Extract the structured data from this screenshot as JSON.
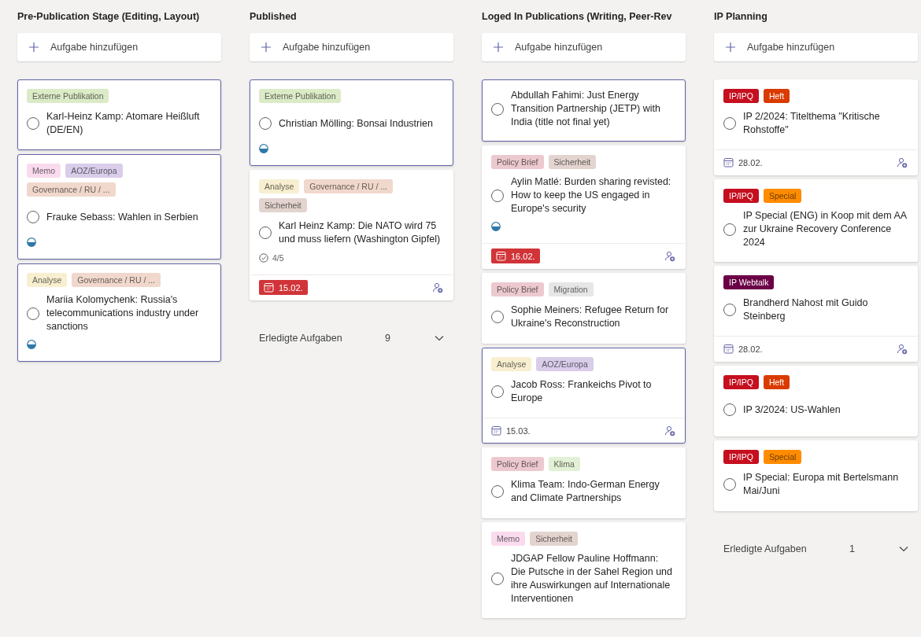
{
  "columns": [
    {
      "title": "Pre-Publication Stage (Editing, Layout)",
      "add_label": "Aufgabe hinzufügen",
      "cards": [
        {
          "selected": true,
          "labels": [
            {
              "text": "Externe Publikation",
              "color": "#dbebc7"
            }
          ],
          "title": "Karl-Heinz Kamp: Atomare Heißluft (DE/EN)",
          "in_progress": false
        },
        {
          "selected": true,
          "labels": [
            {
              "text": "Memo",
              "color": "#fadbee"
            },
            {
              "text": "AOZ/Europa",
              "color": "#d9cdea"
            },
            {
              "text": "Governance / RU / ...",
              "color": "#f1d8cc"
            }
          ],
          "title": "Frauke Sebass: Wahlen in Serbien",
          "in_progress": true
        },
        {
          "selected": true,
          "labels": [
            {
              "text": "Analyse",
              "color": "#f7efd0"
            },
            {
              "text": "Governance / RU / ...",
              "color": "#f1d8cc"
            }
          ],
          "title": "Mariia Kolomychenk: Russia's telecommunications industry under sanctions",
          "in_progress": true
        }
      ]
    },
    {
      "title": "Published",
      "add_label": "Aufgabe hinzufügen",
      "cards": [
        {
          "selected": true,
          "labels": [
            {
              "text": "Externe Publikation",
              "color": "#dbebc7"
            }
          ],
          "title": "Christian Mölling: Bonsai Industrien",
          "in_progress": true
        },
        {
          "selected": false,
          "labels": [
            {
              "text": "Analyse",
              "color": "#f7efd0"
            },
            {
              "text": "Governance / RU / ...",
              "color": "#f1d8cc"
            },
            {
              "text": "Sicherheit",
              "color": "#e3d4cf"
            }
          ],
          "title": "Karl Heinz Kamp: Die NATO wird 75 und muss liefern (Washington Gipfel)",
          "in_progress": false,
          "checklist": "4/5",
          "due": {
            "date": "15.02.",
            "overdue": true
          }
        }
      ],
      "completed": {
        "label": "Erledigte Aufgaben",
        "count": "9"
      }
    },
    {
      "title": "Loged In Publications (Writing, Peer-Rev",
      "add_label": "Aufgabe hinzufügen",
      "cards": [
        {
          "selected": true,
          "title": "Abdullah Fahimi: Just Energy Transition Partnership (JETP) with India (title not final yet)",
          "in_progress": false
        },
        {
          "selected": false,
          "labels": [
            {
              "text": "Policy Brief",
              "color": "#ecc9cf"
            },
            {
              "text": "Sicherheit",
              "color": "#e3d4cf"
            }
          ],
          "title": "Aylin Matlé: Burden sharing revisted: How to keep the US engaged in Europe's security",
          "in_progress": true,
          "due": {
            "date": "16.02.",
            "overdue": true
          }
        },
        {
          "selected": false,
          "labels": [
            {
              "text": "Policy Brief",
              "color": "#ecc9cf"
            },
            {
              "text": "Migration",
              "color": "#e6e6e6"
            }
          ],
          "title": "Sophie Meiners: Refugee Return for Ukraine's Reconstruction",
          "in_progress": false
        },
        {
          "selected": true,
          "labels": [
            {
              "text": "Analyse",
              "color": "#f7efd0"
            },
            {
              "text": "AOZ/Europa",
              "color": "#d9cdea"
            }
          ],
          "title": "Jacob Ross: Frankeichs Pivot to Europe",
          "in_progress": false,
          "due": {
            "date": "15.03.",
            "overdue": false
          }
        },
        {
          "selected": false,
          "labels": [
            {
              "text": "Policy Brief",
              "color": "#ecc9cf"
            },
            {
              "text": "Klima",
              "color": "#e2f0d5"
            }
          ],
          "title": "Klima Team: Indo-German Energy and Climate Partnerships",
          "in_progress": false
        },
        {
          "selected": false,
          "labels": [
            {
              "text": "Memo",
              "color": "#fadbee"
            },
            {
              "text": "Sicherheit",
              "color": "#e3d4cf"
            }
          ],
          "title": "JDGAP Fellow Pauline Hoffmann: Die Putsche in der Sahel Region und ihre Auswirkungen auf Internationale Interventionen",
          "in_progress": false
        }
      ]
    },
    {
      "title": "IP Planning",
      "add_label": "Aufgabe hinzufügen",
      "cards": [
        {
          "selected": false,
          "labels": [
            {
              "text": "IP/IPQ",
              "color": "#c50f1f"
            },
            {
              "text": "Heft",
              "color": "#da3b01"
            }
          ],
          "title": "IP 2/2024: Titelthema \"Kritische Rohstoffe\"",
          "in_progress": false,
          "due": {
            "date": "28.02.",
            "overdue": false
          }
        },
        {
          "selected": false,
          "labels": [
            {
              "text": "IP/IPQ",
              "color": "#c50f1f"
            },
            {
              "text": "Special",
              "color": "#ff8c00"
            }
          ],
          "title": "IP Special (ENG) in Koop mit dem AA zur Ukraine Recovery Conference 2024",
          "in_progress": false
        },
        {
          "selected": false,
          "labels": [
            {
              "text": "IP Webtalk",
              "color": "#6b0046"
            }
          ],
          "title": "Brandherd Nahost mit Guido Steinberg",
          "in_progress": false,
          "due": {
            "date": "28.02.",
            "overdue": false
          }
        },
        {
          "selected": false,
          "labels": [
            {
              "text": "IP/IPQ",
              "color": "#c50f1f"
            },
            {
              "text": "Heft",
              "color": "#da3b01"
            }
          ],
          "title": "IP 3/2024: US-Wahlen",
          "in_progress": false
        },
        {
          "selected": false,
          "labels": [
            {
              "text": "IP/IPQ",
              "color": "#c50f1f"
            },
            {
              "text": "Special",
              "color": "#ff8c00"
            }
          ],
          "title": "IP Special: Europa mit Bertelsmann Mai/Juni",
          "in_progress": false
        }
      ],
      "completed": {
        "label": "Erledigte Aufgaben",
        "count": "1"
      }
    }
  ]
}
